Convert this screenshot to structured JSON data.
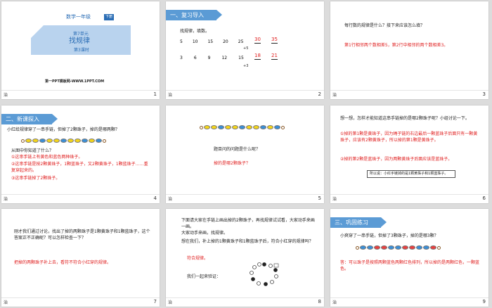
{
  "s1": {
    "grade": "数学一年级",
    "badge": "下册",
    "unit": "第7单元",
    "title": "找规律",
    "lesson": "第3课时",
    "site": "第一PPT模板网-WWW.1PPT.COM",
    "num": "1",
    "foot": "治"
  },
  "s2": {
    "section": "一、复习导入",
    "prompt": "找规律，填数。",
    "row1": [
      "5",
      "10",
      "15",
      "20",
      "25"
    ],
    "row1_ans": [
      "30",
      "35"
    ],
    "row2": [
      "3",
      "6",
      "9",
      "12",
      "15"
    ],
    "row2_ans": [
      "18",
      "21"
    ],
    "plus1": "+5",
    "plus2": "+3",
    "num": "2",
    "foot": "治"
  },
  "s3": {
    "q": "每行数的规律是什么？接下来应该怎么填？",
    "a": "第1行相邻两个数相差5，第2行中相邻的两个数相差3。",
    "num": "3",
    "foot": "治"
  },
  "s4": {
    "section": "二、新课探入",
    "q": "小红给规律穿了一串手链，但掉了2颗珠子，掉的是哪两颗？",
    "q2": "从图中你知道了什么？",
    "a1": "①这串手链上有黄色和蓝色两种珠子。",
    "a2": "②这串手链是按2颗黄珠子，1颗蓝珠子，又2颗黄珠子，1颗蓝珠子……重复穿起来的。",
    "a3": "③这串手链掉了2颗珠子。",
    "num": "4",
    "foot": "治"
  },
  "s5": {
    "q": "题目问的问题是什么呢？",
    "a": "掉的是哪2颗珠子？",
    "num": "5",
    "foot": "治"
  },
  "s6": {
    "q": "想一想，怎样才能知道这串手链掉的是哪2颗珠子呢？小组讨论一下。",
    "a1": "①掉的第1颗是黄珠子，因为绳子链的右边最后一颗蓝珠子后面只有一颗黄珠子，应该有2颗黄珠子，所以掉的第1颗是黄珠子。",
    "a2": "②掉的第2颗是蓝珠子，因为两颗黄珠子后面应该是蓝珠子。",
    "box": "所以说：小红手链掉的是1颗黄珠子和1颗蓝珠子。",
    "num": "6",
    "foot": "治"
  },
  "s7": {
    "q": "刚才我们通过讨论，找出了掉的两颗珠子是1颗黄珠子和1颗蓝珠子，这个答案正不正确呢？可以怎样检查一下？",
    "a": "把掉的两颗珠子补上去，看符不符合小红穿的规律。",
    "num": "7",
    "foot": "治"
  },
  "s8": {
    "q": "下面请大家在手链上画出掉的2颗珠子，再找规律试试看，大家动手来画一画。",
    "q2": "大家动手来画，找规律。",
    "q3": "想在我们，补上掉的1颗黄珠子和1颗蓝珠子后，符合小红穿的规律吗？",
    "a": "符合规律。",
    "check": "我们一起来验证：",
    "num": "8",
    "foot": "治"
  },
  "s9": {
    "section": "三、巩固练习",
    "q": "小爽穿了一串手链，但掉了3颗珠子，掉的是哪3颗？",
    "a": "答：可以珠子是按照两颗蓝色两颗红色排列，所以掉的是两颗红色，一颗蓝色。",
    "num": "9",
    "foot": "治"
  }
}
